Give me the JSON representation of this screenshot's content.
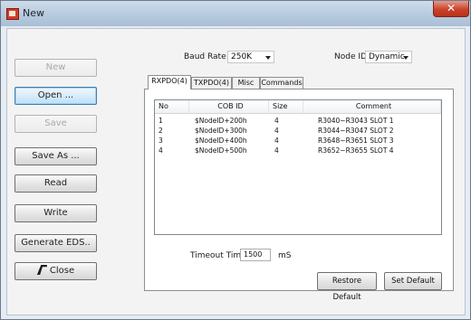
{
  "window": {
    "title": "New",
    "close_glyph": "✕"
  },
  "sidebar": {
    "buttons": [
      {
        "label": "New",
        "state": "disabled"
      },
      {
        "label": "Open ...",
        "state": "focused"
      },
      {
        "label": "Save",
        "state": "disabled"
      },
      {
        "label": "Save As ...",
        "state": "normal"
      },
      {
        "label": "Read",
        "state": "normal"
      },
      {
        "label": "Write",
        "state": "normal"
      },
      {
        "label": "Generate EDS..",
        "state": "normal"
      },
      {
        "label": "Close",
        "state": "normal",
        "icon": "close-doc-icon"
      }
    ]
  },
  "settings": {
    "baud_label": "Baud Rate :",
    "baud_value": "250K",
    "nodeid_label": "Node ID :",
    "nodeid_value": "Dynamic"
  },
  "tabs": [
    {
      "label": "RXPDO(4)",
      "active": true
    },
    {
      "label": "TXPDO(4)",
      "active": false
    },
    {
      "label": "Misc",
      "active": false
    },
    {
      "label": "Commands",
      "active": false
    }
  ],
  "table": {
    "columns": [
      "No",
      "COB ID",
      "Size",
      "Comment"
    ],
    "rows": [
      {
        "no": "1",
        "cob_id": "$NodeID+200h",
        "size": "4",
        "comment": "R3040~R3043 SLOT 1"
      },
      {
        "no": "2",
        "cob_id": "$NodeID+300h",
        "size": "4",
        "comment": "R3044~R3047 SLOT 2"
      },
      {
        "no": "3",
        "cob_id": "$NodeID+400h",
        "size": "4",
        "comment": "R3648~R3651 SLOT 3"
      },
      {
        "no": "4",
        "cob_id": "$NodeID+500h",
        "size": "4",
        "comment": "R3652~R3655 SLOT 4"
      }
    ]
  },
  "timeout": {
    "label": "Timeout Time :",
    "value": "1500",
    "unit": "mS"
  },
  "actions": {
    "restore_default": "Restore Default",
    "set_default": "Set Default"
  }
}
